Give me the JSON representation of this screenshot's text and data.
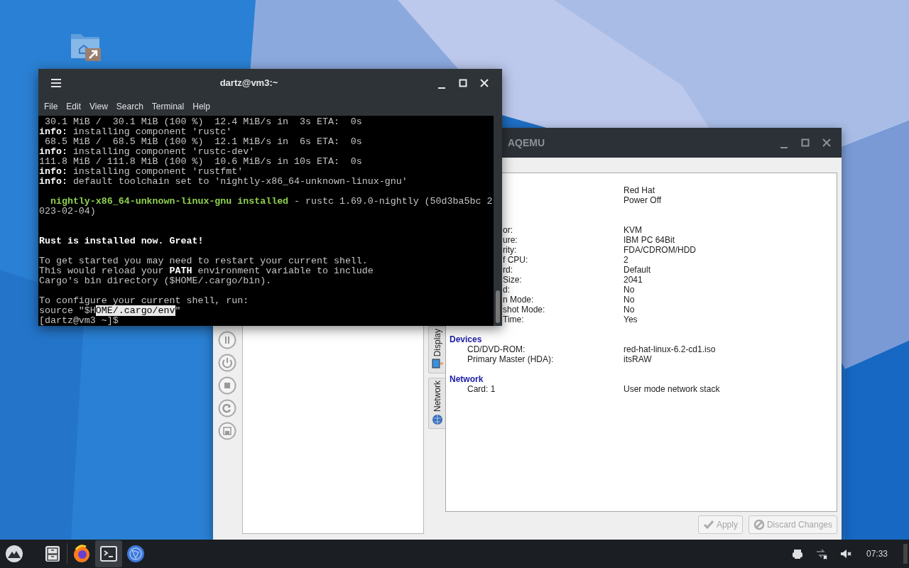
{
  "terminal": {
    "title": "dartz@vm3:~",
    "menu": [
      "File",
      "Edit",
      "View",
      "Search",
      "Terminal",
      "Help"
    ],
    "lines": [
      {
        "segments": [
          {
            "text": " 30.1 MiB /  30.1 MiB (100 %)  12.4 MiB/s in  3s ETA:  0s"
          }
        ]
      },
      {
        "segments": [
          {
            "text": "info:",
            "kind": "bold"
          },
          {
            "text": " installing component 'rustc'"
          }
        ]
      },
      {
        "segments": [
          {
            "text": " 68.5 MiB /  68.5 MiB (100 %)  12.1 MiB/s in  6s ETA:  0s"
          }
        ]
      },
      {
        "segments": [
          {
            "text": "info:",
            "kind": "bold"
          },
          {
            "text": " installing component 'rustc-dev'"
          }
        ]
      },
      {
        "segments": [
          {
            "text": "111.8 MiB / 111.8 MiB (100 %)  10.6 MiB/s in 10s ETA:  0s"
          }
        ]
      },
      {
        "segments": [
          {
            "text": "info:",
            "kind": "bold"
          },
          {
            "text": " installing component 'rustfmt'"
          }
        ]
      },
      {
        "segments": [
          {
            "text": "info:",
            "kind": "bold"
          },
          {
            "text": " default toolchain set to 'nightly-x86_64-unknown-linux-gnu'"
          }
        ]
      },
      {
        "kind": "blank"
      },
      {
        "segments": [
          {
            "text": "  nightly-x86_64-unknown-linux-gnu installed",
            "kind": "green"
          },
          {
            "text": " - rustc 1.69.0-nightly (50d3ba5bc 2"
          }
        ]
      },
      {
        "segments": [
          {
            "text": "023-02-04)"
          }
        ]
      },
      {
        "kind": "blank"
      },
      {
        "kind": "blank"
      },
      {
        "segments": [
          {
            "text": "Rust is installed now. Great!",
            "kind": "bold"
          }
        ]
      },
      {
        "kind": "blank"
      },
      {
        "segments": [
          {
            "text": "To get started you may need to restart your current shell."
          }
        ]
      },
      {
        "segments": [
          {
            "text": "This would reload your "
          },
          {
            "text": "PATH",
            "kind": "bold"
          },
          {
            "text": " environment variable to include"
          }
        ]
      },
      {
        "segments": [
          {
            "text": "Cargo's bin directory ($HOME/.cargo/bin)."
          }
        ]
      },
      {
        "kind": "blank"
      },
      {
        "segments": [
          {
            "text": "To configure your current shell, run:"
          }
        ]
      },
      {
        "segments": [
          {
            "text": "source \"$H"
          },
          {
            "text": "OME/.cargo/env",
            "kind": "selected"
          },
          {
            "text": "\""
          }
        ]
      },
      {
        "segments": [
          {
            "text": "[dartz@vm3 ~]$"
          }
        ]
      }
    ]
  },
  "aqemu": {
    "title": "AQEMU",
    "toolbar_buttons": [
      {
        "kind": "pause"
      },
      {
        "kind": "power"
      },
      {
        "kind": "stop"
      },
      {
        "kind": "reset"
      },
      {
        "kind": "save"
      }
    ],
    "tabs": [
      {
        "label": "Display",
        "kind": "display",
        "selected": false
      },
      {
        "label": "Network",
        "kind": "network",
        "selected": false
      }
    ],
    "sections": [
      {
        "rows": [
          {
            "value": "Red Hat"
          },
          {
            "value": "Power Off"
          }
        ]
      },
      {
        "rows": [
          {
            "label": "or:",
            "value": "KVM"
          },
          {
            "label": "ure:",
            "value": "IBM PC 64Bit"
          },
          {
            "label": "rity:",
            "value": "FDA/CDROM/HDD"
          },
          {
            "label": "f CPU:",
            "value": "2"
          },
          {
            "label": "rd:",
            "value": "Default"
          },
          {
            "label": "Size:",
            "value": "2041"
          },
          {
            "label": "d:",
            "value": "No"
          },
          {
            "label": "n Mode:",
            "value": "No"
          },
          {
            "label": "shot Mode:",
            "value": "No"
          },
          {
            "label": "Time:",
            "value": "Yes"
          }
        ]
      },
      {
        "heading": "Devices",
        "rows": [
          {
            "label": "CD/DVD-ROM:",
            "value": "red-hat-linux-6.2-cd1.iso"
          },
          {
            "label": "Primary Master (HDA):",
            "value": "itsRAW"
          }
        ]
      },
      {
        "heading": "Network",
        "rows": [
          {
            "label": "Card: 1",
            "value": "User mode network stack"
          }
        ]
      }
    ],
    "buttons": [
      {
        "label": "Apply",
        "kind": "apply",
        "disabled": true
      },
      {
        "label": "Discard Changes",
        "kind": "discard",
        "disabled": true
      }
    ]
  },
  "taskbar": {
    "apps": [
      {
        "kind": "files",
        "selected": false
      },
      {
        "kind": "browser",
        "selected": false
      },
      {
        "kind": "terminal",
        "selected": true
      },
      {
        "kind": "globe",
        "selected": false
      }
    ],
    "tray": [
      {
        "kind": "printer"
      },
      {
        "kind": "network"
      },
      {
        "kind": "volume-muted"
      }
    ],
    "clock": "07:33"
  }
}
